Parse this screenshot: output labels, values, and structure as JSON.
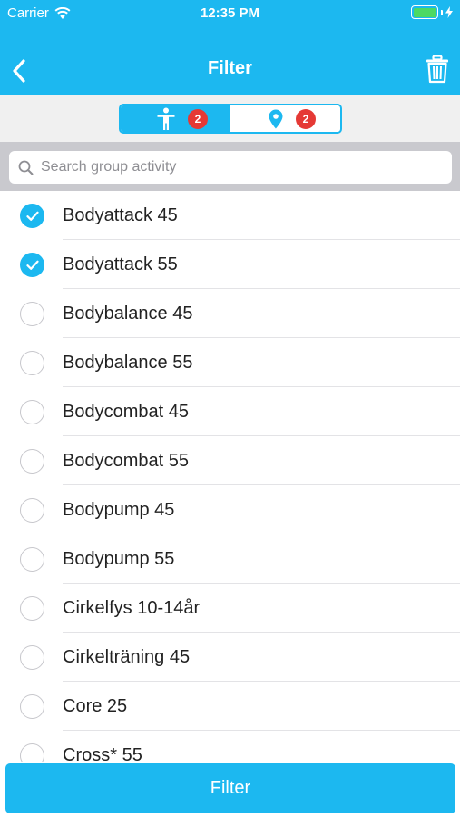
{
  "status_bar": {
    "carrier": "Carrier",
    "time": "12:35 PM"
  },
  "nav": {
    "title": "Filter",
    "back_icon": "chevron-left-icon",
    "trash_icon": "trash-icon"
  },
  "segments": [
    {
      "icon": "person-icon",
      "badge": "2",
      "active": true
    },
    {
      "icon": "location-pin-icon",
      "badge": "2",
      "active": false
    }
  ],
  "search": {
    "placeholder": "Search group activity",
    "value": ""
  },
  "activities": [
    {
      "label": "Bodyattack 45",
      "checked": true
    },
    {
      "label": "Bodyattack 55",
      "checked": true
    },
    {
      "label": "Bodybalance 45",
      "checked": false
    },
    {
      "label": "Bodybalance 55",
      "checked": false
    },
    {
      "label": "Bodycombat 45",
      "checked": false
    },
    {
      "label": "Bodycombat 55",
      "checked": false
    },
    {
      "label": "Bodypump 45",
      "checked": false
    },
    {
      "label": "Bodypump 55",
      "checked": false
    },
    {
      "label": "Cirkelfys 10-14år",
      "checked": false
    },
    {
      "label": "Cirkelträning 45",
      "checked": false
    },
    {
      "label": "Core 25",
      "checked": false
    },
    {
      "label": "Cross* 55",
      "checked": false
    }
  ],
  "footer": {
    "filter_label": "Filter"
  },
  "colors": {
    "accent": "#1cb8f0",
    "badge": "#e53935",
    "battery": "#4cd964"
  }
}
